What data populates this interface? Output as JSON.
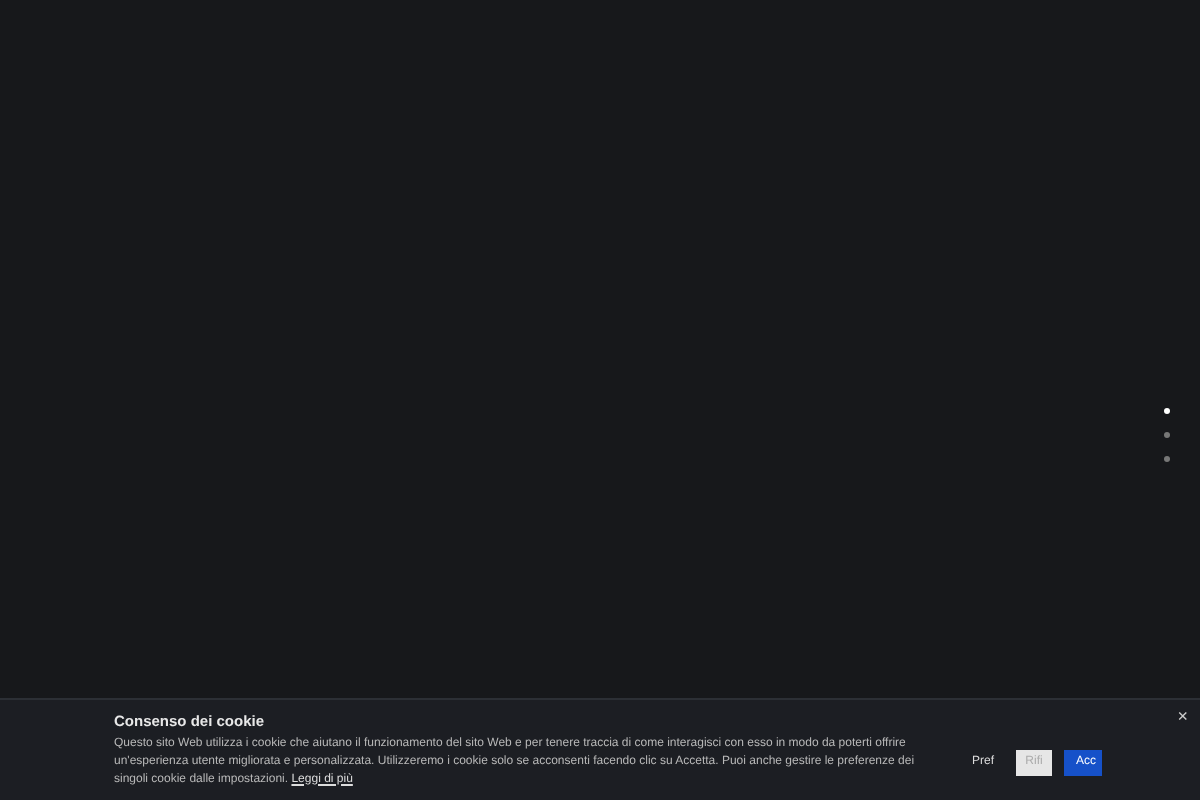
{
  "slide_dots": [
    {
      "selected": true
    },
    {
      "selected": false
    },
    {
      "selected": false
    }
  ],
  "cookie_banner": {
    "title": "Consenso dei cookie",
    "text": "Questo sito Web utilizza i cookie che aiutano il funzionamento del sito Web e per tenere traccia di come interagisci con esso in modo da poterti offrire un'esperienza utente migliorata e personalizzata. Utilizzeremo i cookie solo se acconsenti facendo clic su Accetta. Puoi anche gestire le preferenze dei singoli cookie dalle impostazioni.",
    "link": "Leggi di più",
    "close": "×",
    "buttons": [
      {
        "kind": "text",
        "label": "Pref"
      },
      {
        "kind": "light",
        "label": "Rifi"
      },
      {
        "kind": "primary",
        "label": "Acc"
      }
    ]
  }
}
